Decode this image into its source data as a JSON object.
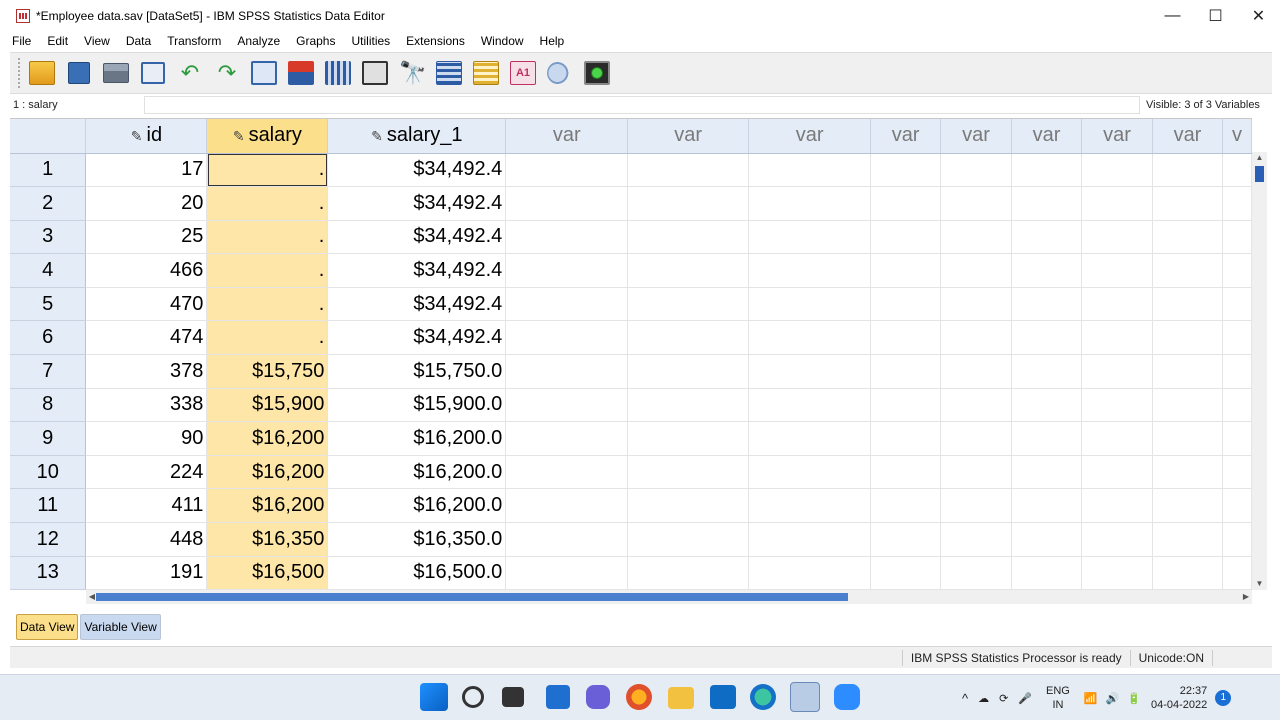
{
  "window": {
    "title": "*Employee data.sav [DataSet5] - IBM SPSS Statistics Data Editor",
    "minimize": "—",
    "maximize": "☐",
    "close": "✕"
  },
  "menu": [
    "File",
    "Edit",
    "View",
    "Data",
    "Transform",
    "Analyze",
    "Graphs",
    "Utilities",
    "Extensions",
    "Window",
    "Help"
  ],
  "toolbar": {
    "icons": [
      "open-icon",
      "save-icon",
      "print-icon",
      "recall-dialog-icon",
      "undo-icon",
      "redo-icon",
      "goto-case-icon",
      "insert-cases-icon",
      "insert-variable-icon",
      "split-file-icon",
      "find-icon",
      "select-cases-icon",
      "weight-cases-icon",
      "value-labels-icon",
      "use-sets-icon",
      "extensions-icon"
    ],
    "labels_icon_text": "A",
    "labels_icon_num": "1",
    "undo_glyph": "↶",
    "redo_glyph": "↷",
    "find_glyph": "🔭"
  },
  "refbar": {
    "cell_ref": "1 : salary",
    "cell_value": "",
    "visible": "Visible: 3 of 3 Variables"
  },
  "grid": {
    "columns": [
      {
        "name": "id",
        "type": "measure"
      },
      {
        "name": "salary",
        "type": "measure",
        "selected": true
      },
      {
        "name": "salary_1",
        "type": "measure"
      },
      {
        "name": "var",
        "type": "empty"
      },
      {
        "name": "var",
        "type": "empty"
      },
      {
        "name": "var",
        "type": "empty"
      },
      {
        "name": "var",
        "type": "empty"
      },
      {
        "name": "var",
        "type": "empty"
      },
      {
        "name": "var",
        "type": "empty"
      },
      {
        "name": "var",
        "type": "empty"
      },
      {
        "name": "var",
        "type": "empty"
      },
      {
        "name": "v",
        "type": "empty"
      }
    ],
    "pencil_glyph": "✎",
    "rows": [
      {
        "n": "1",
        "id": "17",
        "salary": ".",
        "salary_1": "$34,492.4"
      },
      {
        "n": "2",
        "id": "20",
        "salary": ".",
        "salary_1": "$34,492.4"
      },
      {
        "n": "3",
        "id": "25",
        "salary": ".",
        "salary_1": "$34,492.4"
      },
      {
        "n": "4",
        "id": "466",
        "salary": ".",
        "salary_1": "$34,492.4"
      },
      {
        "n": "5",
        "id": "470",
        "salary": ".",
        "salary_1": "$34,492.4"
      },
      {
        "n": "6",
        "id": "474",
        "salary": ".",
        "salary_1": "$34,492.4"
      },
      {
        "n": "7",
        "id": "378",
        "salary": "$15,750",
        "salary_1": "$15,750.0"
      },
      {
        "n": "8",
        "id": "338",
        "salary": "$15,900",
        "salary_1": "$15,900.0"
      },
      {
        "n": "9",
        "id": "90",
        "salary": "$16,200",
        "salary_1": "$16,200.0"
      },
      {
        "n": "10",
        "id": "224",
        "salary": "$16,200",
        "salary_1": "$16,200.0"
      },
      {
        "n": "11",
        "id": "411",
        "salary": "$16,200",
        "salary_1": "$16,200.0"
      },
      {
        "n": "12",
        "id": "448",
        "salary": "$16,350",
        "salary_1": "$16,350.0"
      },
      {
        "n": "13",
        "id": "191",
        "salary": "$16,500",
        "salary_1": "$16,500.0"
      }
    ]
  },
  "tabs": {
    "data_view": "Data View",
    "variable_view": "Variable View"
  },
  "status": {
    "processor": "IBM SPSS Statistics Processor is ready",
    "unicode": "Unicode:ON"
  },
  "taskbar": {
    "icons": [
      "windows-start-icon",
      "search-icon",
      "task-view-icon",
      "widgets-icon",
      "teams-chat-icon",
      "firefox-icon",
      "file-explorer-icon",
      "outlook-icon",
      "edge-icon",
      "spss-icon",
      "zoom-icon"
    ],
    "lang_top": "ENG",
    "lang_bottom": "IN",
    "time": "22:37",
    "date": "04-04-2022",
    "notifications": "1",
    "tray_caret": "^"
  },
  "colors": {
    "header_bg": "#e4ecf7",
    "selected_col": "#fbdf8a",
    "selected_cells": "#fde6a8",
    "tab_active": "#fbdf8a",
    "tab_inactive": "#c9daf0"
  }
}
